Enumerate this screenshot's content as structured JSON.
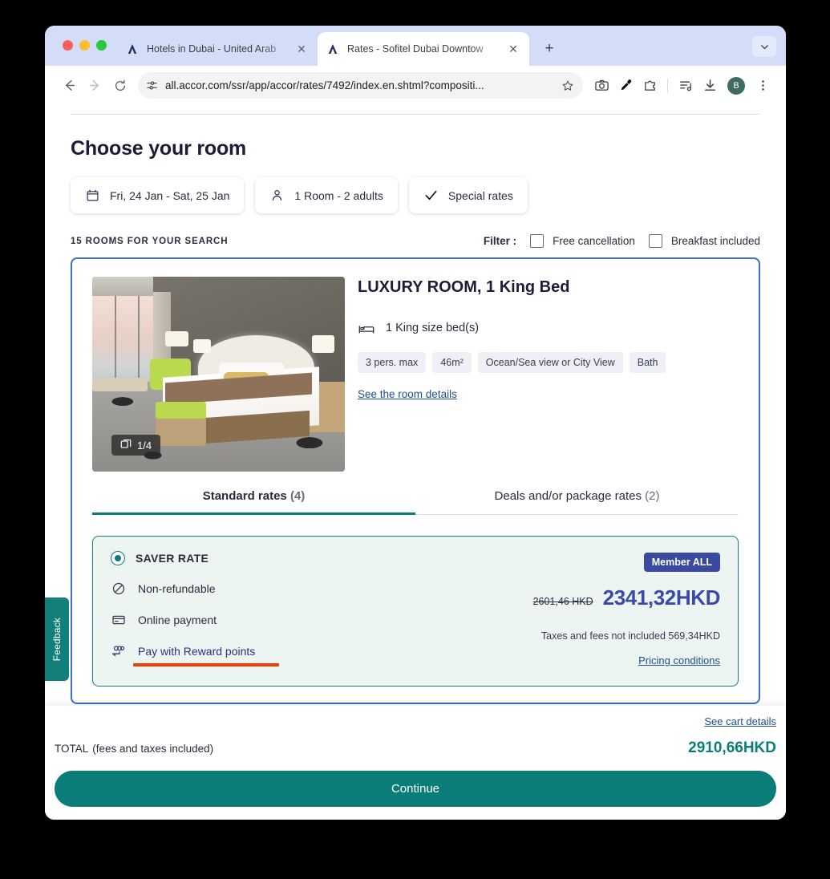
{
  "browser": {
    "tabs": [
      {
        "title": "Hotels in Dubai - United Arab",
        "favicon": "accor-icon",
        "active": false
      },
      {
        "title": "Rates - Sofitel Dubai Downtow",
        "favicon": "accor-icon",
        "active": true
      }
    ],
    "new_tab_label": "+",
    "tab_list_chevron": "chevron-down-icon",
    "url": "all.accor.com/ssr/app/accor/rates/7492/index.en.shtml?compositi...",
    "avatar_initial": "B",
    "nav": {
      "back": "back-arrow-icon",
      "forward": "forward-arrow-icon",
      "reload": "reload-icon"
    },
    "toolbar_icons": [
      "site-settings-icon",
      "bookmark-star-icon",
      "screenshot-camera-icon",
      "eyedropper-icon",
      "extensions-icon",
      "reading-list-icon",
      "downloads-icon",
      "profile-avatar",
      "kebab-menu-icon"
    ]
  },
  "page": {
    "heading": "Choose your room",
    "search_chips": [
      {
        "icon": "calendar-icon",
        "label": "Fri, 24 Jan - Sat, 25 Jan"
      },
      {
        "icon": "person-icon",
        "label": "1 Room - 2 adults"
      },
      {
        "icon": "check-icon",
        "label": "Special rates"
      }
    ],
    "room_count": "15 ROOMS FOR YOUR SEARCH",
    "filter": {
      "label": "Filter :",
      "options": [
        {
          "label": "Free cancellation",
          "checked": false
        },
        {
          "label": "Breakfast included",
          "checked": false
        }
      ]
    },
    "room": {
      "photo_badge": "1/4",
      "photo_badge_icon": "gallery-icon",
      "title": "LUXURY ROOM, 1 King Bed",
      "bed_icon": "bed-icon",
      "bed_label": "1 King size bed(s)",
      "tags": [
        "3 pers. max",
        "46m²",
        "Ocean/Sea view or City View",
        "Bath"
      ],
      "details_link": "See the room details",
      "tabs": [
        {
          "label": "Standard rates",
          "count": "(4)",
          "selected": true
        },
        {
          "label": "Deals and/or package rates",
          "count": "(2)",
          "selected": false
        }
      ]
    },
    "rate": {
      "selected": true,
      "name": "SAVER RATE",
      "features": [
        {
          "icon": "no-refund-icon",
          "label": "Non-refundable",
          "is_link": false
        },
        {
          "icon": "credit-card-icon",
          "label": "Online payment",
          "is_link": false
        },
        {
          "icon": "reward-points-icon",
          "label": "Pay with Reward points",
          "is_link": true,
          "annotated": true
        }
      ],
      "badge": "Member ALL",
      "old_price": "2601,46 HKD",
      "new_price": "2341,32HKD",
      "tax_note": "Taxes and fees not included 569,34HKD",
      "pricing_link": "Pricing conditions"
    },
    "footer": {
      "cart_link": "See cart details",
      "total_label": "TOTAL",
      "total_note": "(fees and taxes included)",
      "total_value": "2910,66HKD",
      "continue_label": "Continue"
    },
    "feedback_tab": "Feedback"
  },
  "colors": {
    "accent_teal": "#0a7d78",
    "card_border_blue": "#3f6ec4",
    "rate_border_teal": "#16817a",
    "rate_bg": "#edf5f3",
    "member_badge": "#3a4a9f",
    "price_blue": "#3a4aa8",
    "annotation_red": "#f43c00",
    "link_blue": "#1f4e8c"
  }
}
